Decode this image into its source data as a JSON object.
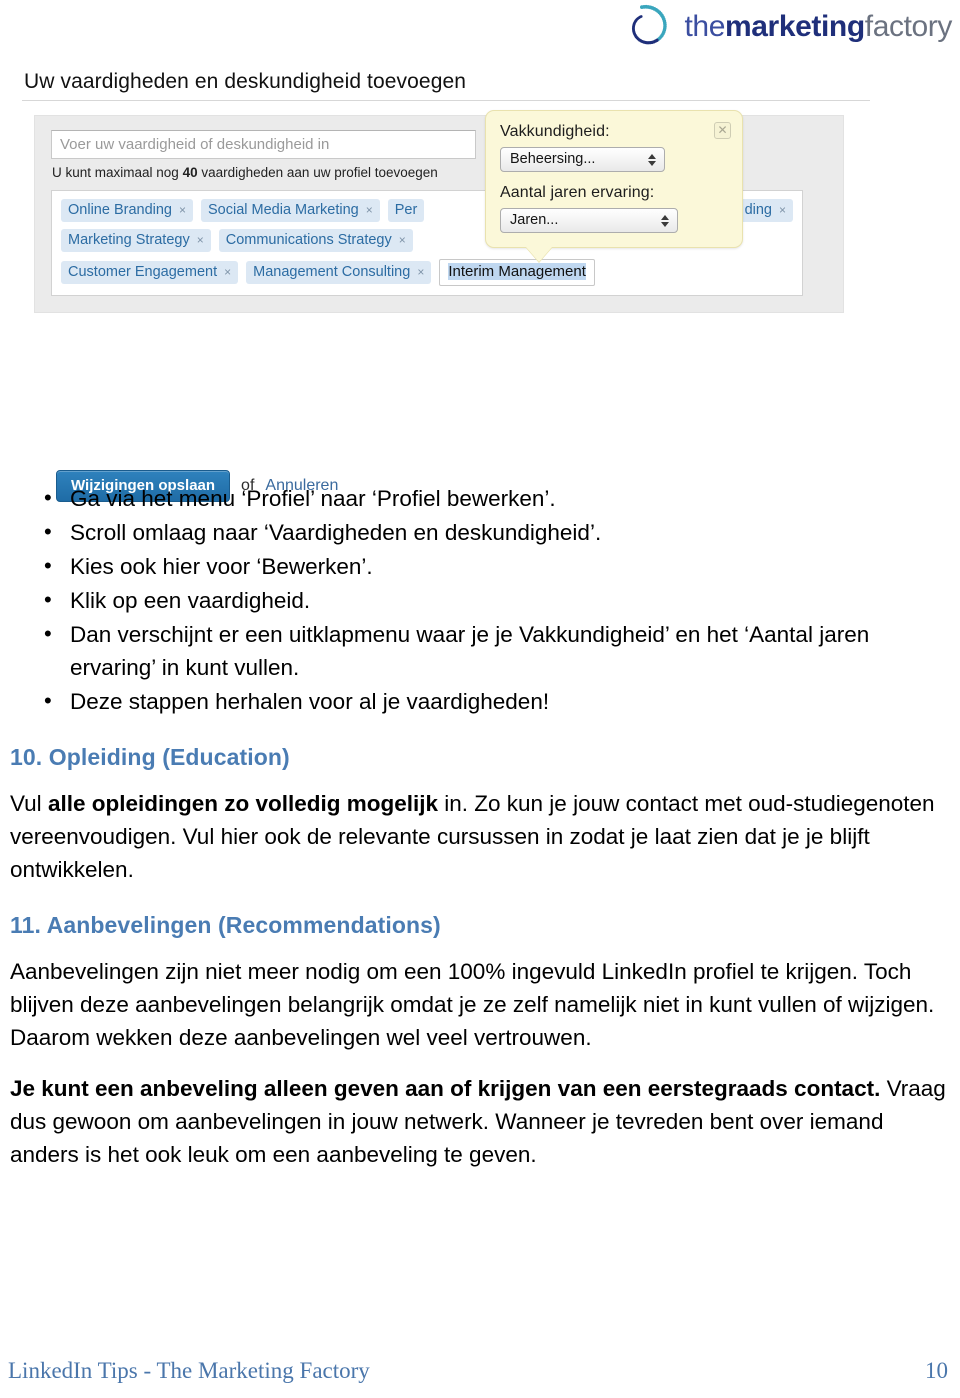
{
  "logo": {
    "icon": "dotted-spiral-icon",
    "text_the": "the",
    "text_marketing": "marketing",
    "text_factory": "factory",
    "color_dark": "#1f2f7a",
    "color_teal": "#3aa6bd"
  },
  "screenshot": {
    "title": "Uw vaardigheden en deskundigheid toevoegen",
    "skill_input": {
      "value": "",
      "placeholder": "Voer uw vaardigheid of deskundigheid in"
    },
    "hint_prefix": "U kunt maximaal nog ",
    "hint_count": "40",
    "hint_suffix": " vaardigheden aan uw profiel toevoegen",
    "tag_rows": [
      [
        {
          "label": "Online Branding",
          "remove": "×",
          "clipped": false
        },
        {
          "label": "Social Media Marketing",
          "remove": "×",
          "clipped": false
        },
        {
          "label": "Per",
          "remove": "",
          "clipped": false
        },
        {
          "label": "ding",
          "remove": "×",
          "clipped": true
        }
      ],
      [
        {
          "label": "Marketing Strategy",
          "remove": "×",
          "clipped": false
        },
        {
          "label": "Communications Strategy",
          "remove": "×",
          "clipped": false
        }
      ],
      [
        {
          "label": "Customer Engagement",
          "remove": "×",
          "clipped": false
        },
        {
          "label": "Management Consulting",
          "remove": "×",
          "clipped": false
        }
      ]
    ],
    "active_tag": "Interim Management",
    "popup": {
      "close_glyph": "✕",
      "label_expertise": "Vakkundigheid:",
      "select_expertise": "Beheersing...",
      "label_years": "Aantal jaren ervaring:",
      "select_years": "Jaren..."
    },
    "save_button": "Wijzigingen opslaan",
    "save_or": "of",
    "cancel_link": "Annuleren"
  },
  "steps": [
    "Ga via het menu ‘Profiel’ naar ‘Profiel bewerken’.",
    "Scroll omlaag naar ‘Vaardigheden en deskundigheid’.",
    "Kies ook hier voor ‘Bewerken’.",
    "Klik op een vaardigheid.",
    "Dan verschijnt er een uitklapmenu waar je je Vakkundigheid’ en het ‘Aantal jaren ervaring’ in kunt vullen.",
    "Deze stappen herhalen voor al je vaardigheden!"
  ],
  "sections": [
    {
      "heading": "10. Opleiding (Education)",
      "paragraphs": [
        {
          "parts": [
            {
              "text": "Vul ",
              "bold": false
            },
            {
              "text": "alle opleidingen zo volledig mogelijk",
              "bold": true
            },
            {
              "text": " in. Zo kun je jouw contact met oud-studiegenoten vereenvoudigen. Vul hier ook de relevante cursussen in zodat je laat zien dat je je blijft ontwikkelen.",
              "bold": false
            }
          ]
        }
      ]
    },
    {
      "heading": "11. Aanbevelingen (Recommendations)",
      "paragraphs": [
        {
          "parts": [
            {
              "text": "Aanbevelingen zijn niet meer nodig om een 100% ingevuld LinkedIn profiel te krijgen. Toch blijven deze aanbevelingen belangrijk omdat je ze zelf namelijk niet in kunt vullen of wijzigen. Daarom wekken deze aanbevelingen wel veel vertrouwen.",
              "bold": false
            }
          ]
        },
        {
          "parts": [
            {
              "text": "Je kunt een anbeveling alleen geven aan of krijgen van een eerstegraads contact.",
              "bold": true
            },
            {
              "text": " Vraag dus gewoon om aanbevelingen in jouw netwerk. Wanneer je tevreden bent over iemand anders is het ook leuk om een aanbeveling te geven.",
              "bold": false
            }
          ]
        }
      ]
    }
  ],
  "footer": {
    "left": "LinkedIn Tips - The Marketing Factory",
    "page": "10"
  }
}
